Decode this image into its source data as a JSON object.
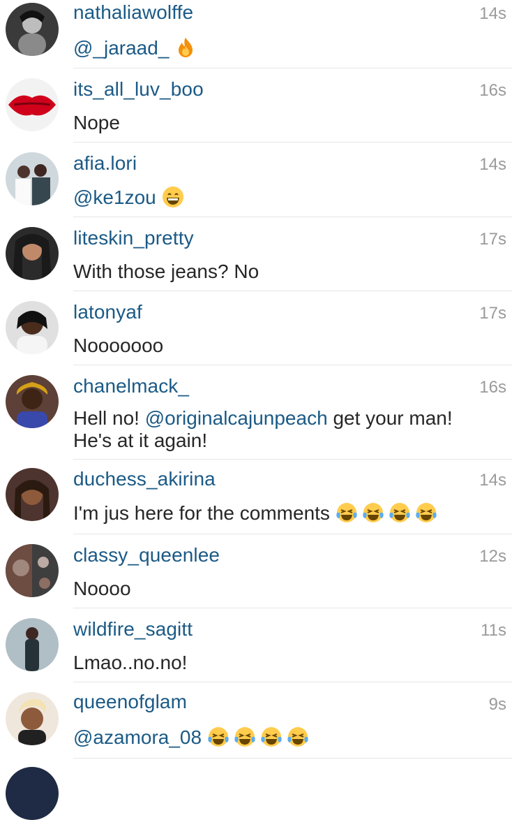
{
  "comments": [
    {
      "username": "nathaliawolffe",
      "time": "14s",
      "mention": "@_jaraad_",
      "text": "",
      "after": "",
      "emoji": "fire",
      "emoji_count": 1
    },
    {
      "username": "its_all_luv_boo",
      "time": "16s",
      "mention": "",
      "text": "Nope",
      "after": "",
      "emoji": "",
      "emoji_count": 0
    },
    {
      "username": "afia.lori",
      "time": "14s",
      "mention": "@ke1zou",
      "text": "",
      "after": "",
      "emoji": "grin",
      "emoji_count": 1
    },
    {
      "username": "liteskin_pretty",
      "time": "17s",
      "mention": "",
      "text": "With those jeans? No",
      "after": "",
      "emoji": "",
      "emoji_count": 0
    },
    {
      "username": "latonyaf",
      "time": "17s",
      "mention": "",
      "text": "Nooooooo",
      "after": "",
      "emoji": "",
      "emoji_count": 0
    },
    {
      "username": "chanelmack_",
      "time": "16s",
      "mention": "@originalcajunpeach",
      "text": "Hell no!",
      "after": "get your man! He's at it again!",
      "emoji": "",
      "emoji_count": 0
    },
    {
      "username": "duchess_akirina",
      "time": "14s",
      "mention": "",
      "text": "I'm jus here for the comments",
      "after": "",
      "emoji": "tears-of-joy",
      "emoji_count": 4
    },
    {
      "username": "classy_queenlee",
      "time": "12s",
      "mention": "",
      "text": "Noooo",
      "after": "",
      "emoji": "",
      "emoji_count": 0
    },
    {
      "username": "wildfire_sagitt",
      "time": "11s",
      "mention": "",
      "text": "Lmao..no.no!",
      "after": "",
      "emoji": "",
      "emoji_count": 0
    },
    {
      "username": "queenofglam",
      "time": "9s",
      "mention": "@azamora_08",
      "text": "",
      "after": "",
      "emoji": "tears-of-joy",
      "emoji_count": 4
    }
  ],
  "colors": {
    "username": "#1b5a86",
    "text": "#262626",
    "time": "#9a9a9a",
    "divider": "#e6e6e6"
  }
}
